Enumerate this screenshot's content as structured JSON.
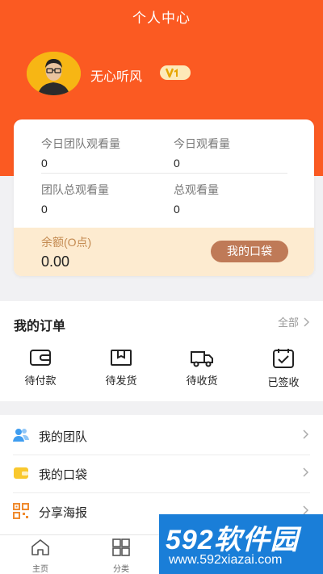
{
  "header": {
    "title": "个人中心"
  },
  "profile": {
    "username": "无心听风",
    "vip_badge": "V₁"
  },
  "stats": [
    {
      "label": "今日团队观看量",
      "value": "0"
    },
    {
      "label": "今日观看量",
      "value": "0"
    },
    {
      "label": "团队总观看量",
      "value": "0"
    },
    {
      "label": "总观看量",
      "value": "0"
    }
  ],
  "balance": {
    "label": "余额(O点)",
    "value": "0.00",
    "button": "我的口袋"
  },
  "orders": {
    "title": "我的订单",
    "all_label": "全部",
    "items": [
      {
        "label": "待付款",
        "icon": "wallet-icon"
      },
      {
        "label": "待发货",
        "icon": "package-icon"
      },
      {
        "label": "待收货",
        "icon": "truck-icon"
      },
      {
        "label": "已签收",
        "icon": "signed-check-icon"
      }
    ]
  },
  "menu": [
    {
      "label": "我的团队",
      "icon": "team-icon"
    },
    {
      "label": "我的口袋",
      "icon": "pocket-icon"
    },
    {
      "label": "分享海报",
      "icon": "qrcode-icon"
    }
  ],
  "tabbar": [
    {
      "label": "主页",
      "icon": "home-icon"
    },
    {
      "label": "分类",
      "icon": "grid-icon"
    }
  ],
  "watermark": {
    "title": "592软件园",
    "url": "www.592xiazai.com"
  },
  "colors": {
    "primary": "#fb5a22",
    "balance_bg": "#fdebd0",
    "pocket_button": "#bf7a57",
    "watermark_bg": "#1a7ed8"
  }
}
